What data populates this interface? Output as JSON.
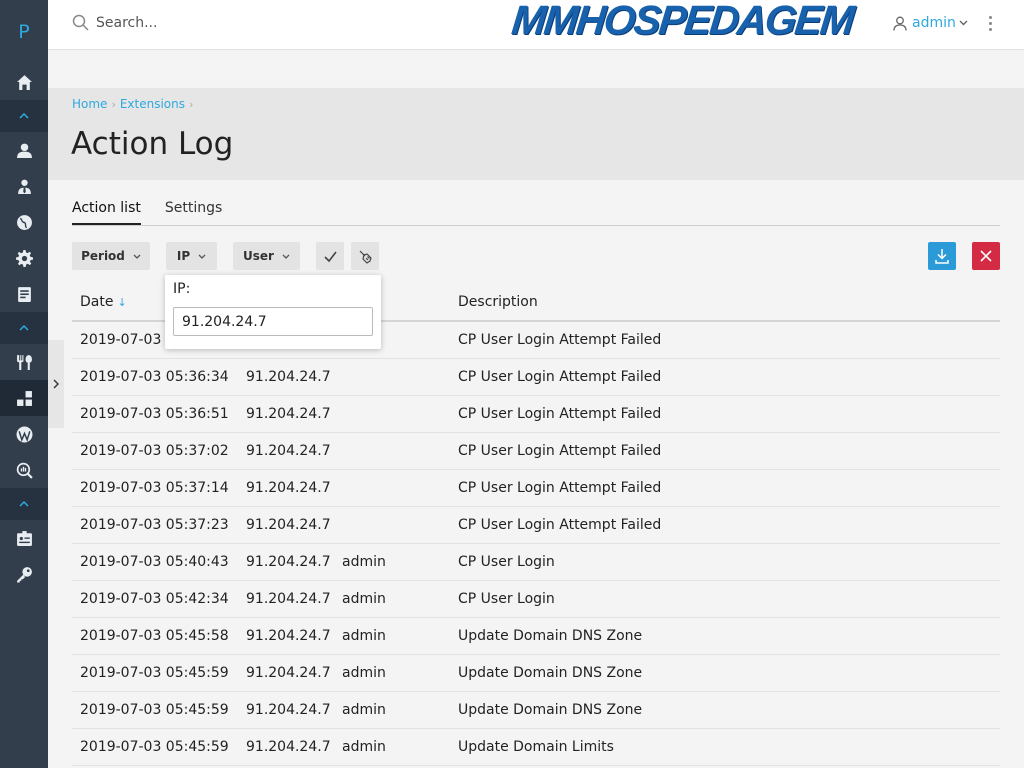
{
  "sidebar": {
    "logo": "P",
    "items": [
      {
        "icon": "home-icon"
      },
      {
        "icon": "user-icon"
      },
      {
        "icon": "user-tie-icon"
      },
      {
        "icon": "globe-icon"
      },
      {
        "icon": "gear-icon"
      },
      {
        "icon": "billing-icon"
      },
      {
        "icon": "tools-icon"
      },
      {
        "icon": "extensions-icon",
        "active": true
      },
      {
        "icon": "wordpress-icon"
      },
      {
        "icon": "monitoring-icon"
      },
      {
        "icon": "server-icon"
      },
      {
        "icon": "key-icon"
      }
    ]
  },
  "header": {
    "search_placeholder": "Search...",
    "brand": "MMHOSPEDAGEM",
    "user": "admin"
  },
  "breadcrumb": {
    "home": "Home",
    "extensions": "Extensions"
  },
  "page_title": "Action Log",
  "tabs": [
    {
      "label": "Action list",
      "active": true
    },
    {
      "label": "Settings",
      "active": false
    }
  ],
  "toolbar": {
    "period": "Period",
    "ip": "IP",
    "user": "User"
  },
  "columns": {
    "date": "Date",
    "description": "Description",
    "sort_arrow": "↓"
  },
  "ip_filter": {
    "label": "IP:",
    "value": "91.204.24.7"
  },
  "rows": [
    {
      "date": "2019-07-03 0",
      "ip": "",
      "user": "",
      "desc": "CP User Login Attempt Failed"
    },
    {
      "date": "2019-07-03 05:36:34",
      "ip": "91.204.24.7",
      "user": "",
      "desc": "CP User Login Attempt Failed"
    },
    {
      "date": "2019-07-03 05:36:51",
      "ip": "91.204.24.7",
      "user": "",
      "desc": "CP User Login Attempt Failed"
    },
    {
      "date": "2019-07-03 05:37:02",
      "ip": "91.204.24.7",
      "user": "",
      "desc": "CP User Login Attempt Failed"
    },
    {
      "date": "2019-07-03 05:37:14",
      "ip": "91.204.24.7",
      "user": "",
      "desc": "CP User Login Attempt Failed"
    },
    {
      "date": "2019-07-03 05:37:23",
      "ip": "91.204.24.7",
      "user": "",
      "desc": "CP User Login Attempt Failed"
    },
    {
      "date": "2019-07-03 05:40:43",
      "ip": "91.204.24.7",
      "user": "admin",
      "desc": "CP User Login"
    },
    {
      "date": "2019-07-03 05:42:34",
      "ip": "91.204.24.7",
      "user": "admin",
      "desc": "CP User Login"
    },
    {
      "date": "2019-07-03 05:45:58",
      "ip": "91.204.24.7",
      "user": "admin",
      "desc": "Update Domain DNS Zone"
    },
    {
      "date": "2019-07-03 05:45:59",
      "ip": "91.204.24.7",
      "user": "admin",
      "desc": "Update Domain DNS Zone"
    },
    {
      "date": "2019-07-03 05:45:59",
      "ip": "91.204.24.7",
      "user": "admin",
      "desc": "Update Domain DNS Zone"
    },
    {
      "date": "2019-07-03 05:45:59",
      "ip": "91.204.24.7",
      "user": "admin",
      "desc": "Update Domain Limits"
    }
  ],
  "colors": {
    "accent": "#2fa8e0",
    "sidebar": "#323e4c",
    "danger": "#d42b45",
    "brand": "#1761ad"
  }
}
